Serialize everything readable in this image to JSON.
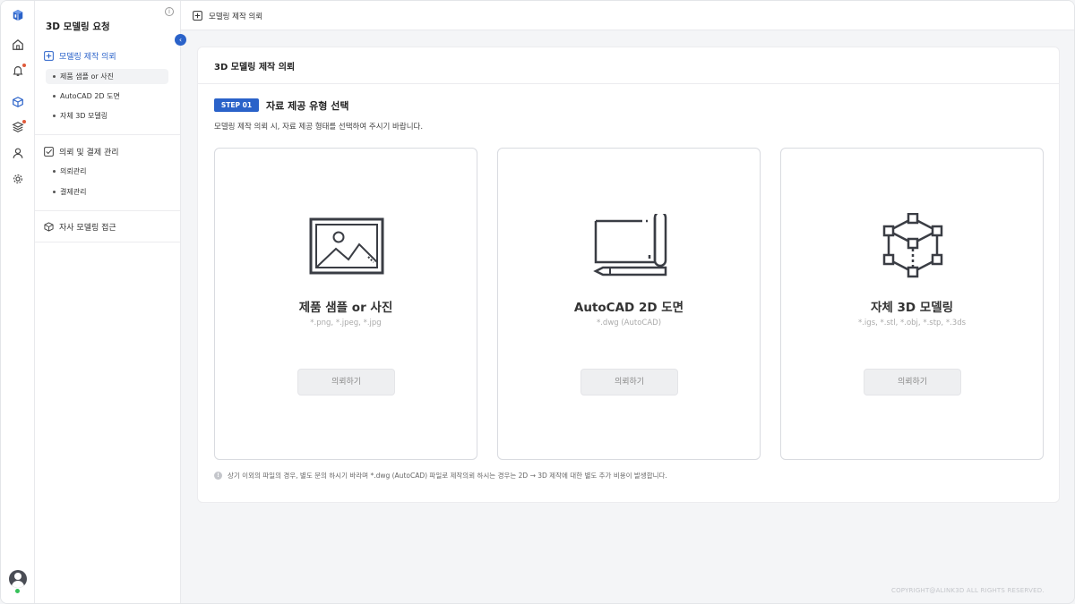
{
  "sidebar": {
    "title": "3D 모델링 요청",
    "info_glyph": "i",
    "collapse_glyph": "‹",
    "sections": [
      {
        "label": "모델링 제작 의뢰",
        "icon": "plus-square-icon",
        "active": true,
        "items": [
          {
            "label": "제품 샘플 or 사진",
            "selected": true
          },
          {
            "label": "AutoCAD 2D 도면"
          },
          {
            "label": "자체 3D 모델링"
          }
        ]
      },
      {
        "label": "의뢰 및 결제 관리",
        "icon": "check-square-icon",
        "items": [
          {
            "label": "의뢰관리"
          },
          {
            "label": "결제관리"
          }
        ]
      },
      {
        "label": "자사 모델링 접근",
        "icon": "cube-icon",
        "items": []
      }
    ]
  },
  "topbar": {
    "breadcrumb": "모델링 제작 의뢰"
  },
  "panel": {
    "title": "3D 모델링 제작 의뢰",
    "step_badge": "STEP 01",
    "step_title": "자료 제공 유형 선택",
    "step_desc": "모델링 제작 의뢰 시, 자료 제공 형태를 선택하여 주시기 바랍니다.",
    "cards": [
      {
        "title": "제품 샘플 or 사진",
        "ext": "*.png, *.jpeg, *.jpg",
        "button": "의뢰하기",
        "icon": "image-icon"
      },
      {
        "title": "AutoCAD 2D 도면",
        "ext": "*.dwg (AutoCAD)",
        "button": "의뢰하기",
        "icon": "blueprint-icon"
      },
      {
        "title": "자체 3D 모델링",
        "ext": "*.igs, *.stl, *.obj, *.stp, *.3ds",
        "button": "의뢰하기",
        "icon": "3d-cube-icon"
      }
    ],
    "note_glyph": "!",
    "note": "상기 이외의 파일의 경우, 별도 문의 하시기 바라며 *.dwg (AutoCAD) 파일로 제작의뢰 하시는 경우는 2D → 3D 제작에 대한 별도 추가 비용이 발생합니다."
  },
  "footer": {
    "copyright": "COPYRIGHT@ALINK3D ALL RIGHTS RESERVED."
  },
  "colors": {
    "accent": "#2a62c9",
    "alert": "#e05a3a",
    "online": "#37c15a"
  }
}
